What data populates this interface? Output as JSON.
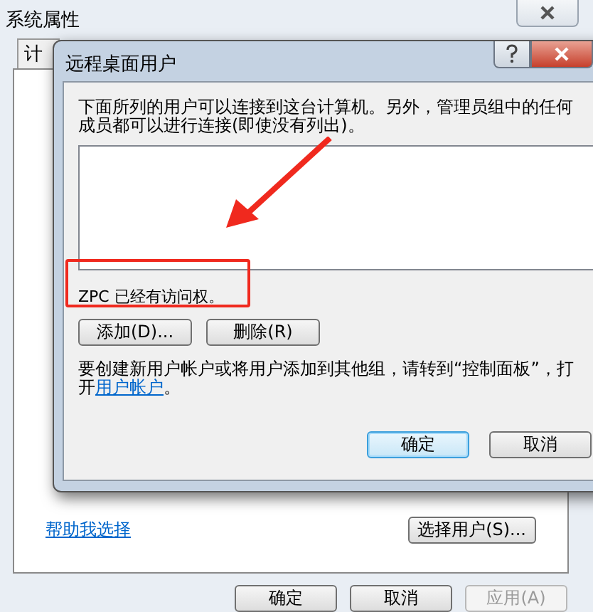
{
  "background_window": {
    "title": "系统属性",
    "tab_label": "计",
    "help_link": "帮助我选择",
    "select_users_button": "选择用户(S)...",
    "buttons": [
      {
        "label": "确定",
        "disabled": false
      },
      {
        "label": "取消",
        "disabled": false
      },
      {
        "label": "应用(A)",
        "disabled": true
      }
    ]
  },
  "dialog": {
    "title": "远程桌面用户",
    "description": "下面所列的用户可以连接到这台计算机。另外，管理员组中的任何成员都可以进行连接(即使没有列出)。",
    "access_note": "ZPC 已经有访问权。",
    "list_buttons": [
      "添加(D)...",
      "删除(R)"
    ],
    "hint": "要创建新用户帐户或将用户添加到其他组，请转到“控制面板”，打开",
    "hint_link": "用户帐户",
    "hint_end": "。",
    "buttons": [
      {
        "label": "确定",
        "default": true
      },
      {
        "label": "取消",
        "default": false
      }
    ]
  }
}
